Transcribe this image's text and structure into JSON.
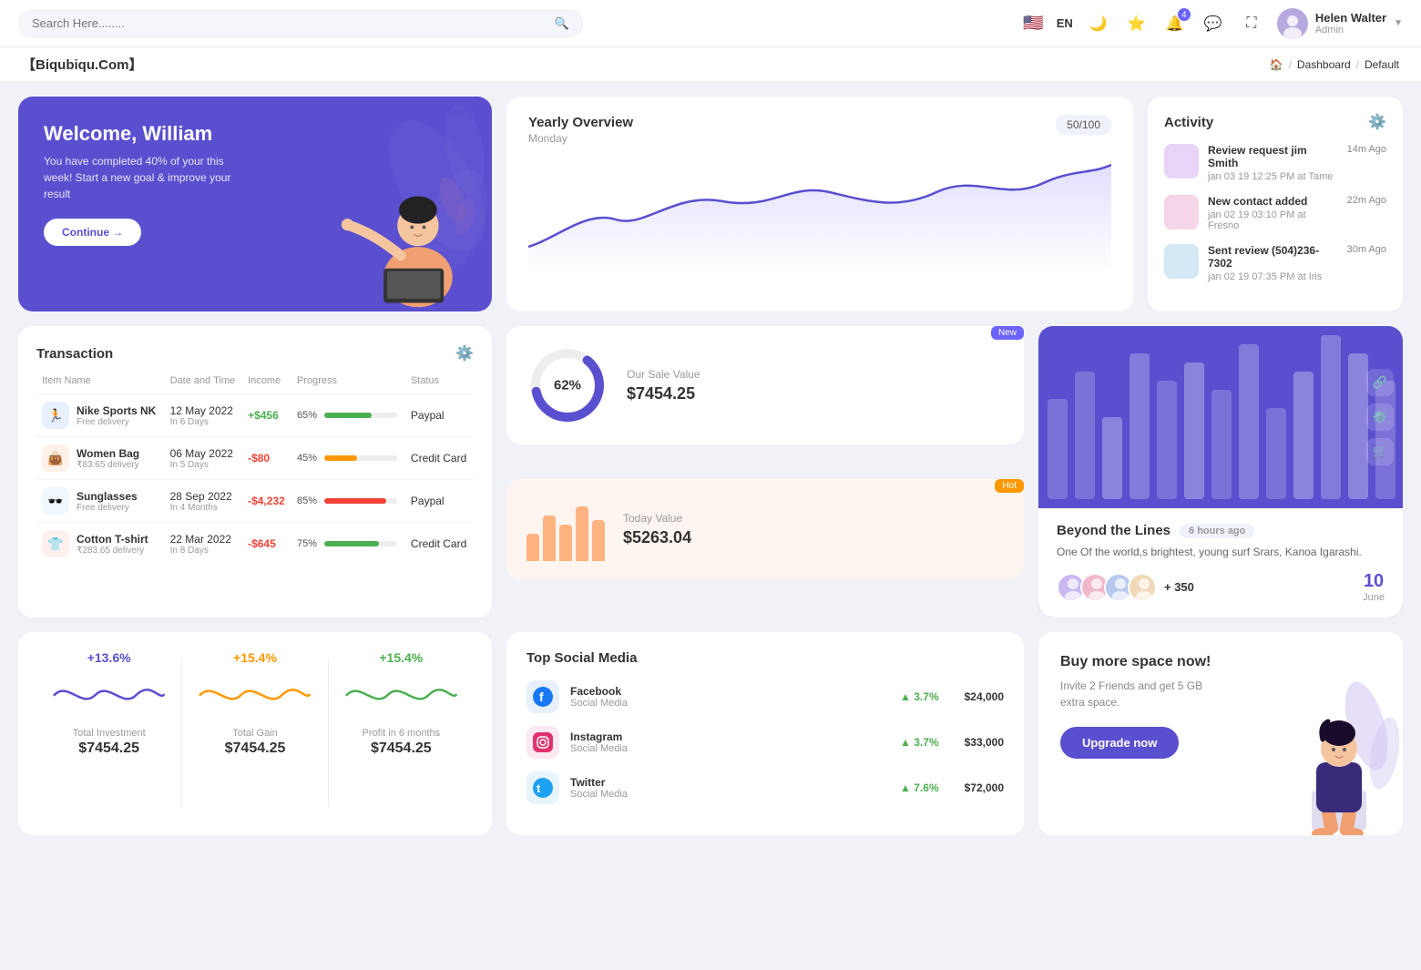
{
  "topnav": {
    "search_placeholder": "Search Here........",
    "lang": "EN",
    "user": {
      "name": "Helen Walter",
      "role": "Admin",
      "avatar_text": "HW"
    },
    "notification_count": "4"
  },
  "breadcrumb": {
    "brand": "【Biqubiqu.Com】",
    "home": "🏠",
    "links": [
      "Dashboard",
      "Default"
    ]
  },
  "welcome": {
    "title": "Welcome, William",
    "description": "You have completed 40% of your this week! Start a new goal & improve your result",
    "button": "Continue →"
  },
  "yearly_overview": {
    "title": "Yearly Overview",
    "subtitle": "Monday",
    "badge": "50/100"
  },
  "activity": {
    "title": "Activity",
    "items": [
      {
        "title": "Review request jim Smith",
        "subtitle": "jan 03 19 12:25 PM at Tame",
        "time": "14m Ago"
      },
      {
        "title": "New contact added",
        "subtitle": "jan 02 19 03:10 PM at Fresno",
        "time": "22m Ago"
      },
      {
        "title": "Sent review (504)236-7302",
        "subtitle": "jan 02 19 07:35 PM at Iris",
        "time": "30m Ago"
      }
    ]
  },
  "transaction": {
    "title": "Transaction",
    "columns": [
      "Item Name",
      "Date and Time",
      "Income",
      "Progress",
      "Status"
    ],
    "rows": [
      {
        "icon": "🏃",
        "icon_bg": "#e8f0ff",
        "name": "Nike Sports NK",
        "desc": "Free delivery",
        "date": "12 May 2022",
        "days": "In 6 Days",
        "income": "+$456",
        "income_type": "pos",
        "progress": 65,
        "progress_color": "#4caf50",
        "status": "Paypal"
      },
      {
        "icon": "👜",
        "icon_bg": "#fff0e8",
        "name": "Women Bag",
        "desc": "₹83.65 delivery",
        "date": "06 May 2022",
        "days": "In 5 Days",
        "income": "-$80",
        "income_type": "neg",
        "progress": 45,
        "progress_color": "#ff9800",
        "status": "Credit Card"
      },
      {
        "icon": "🕶️",
        "icon_bg": "#f0f8ff",
        "name": "Sunglasses",
        "desc": "Free delivery",
        "date": "28 Sep 2022",
        "days": "In 4 Months",
        "income": "-$4,232",
        "income_type": "neg",
        "progress": 85,
        "progress_color": "#f44336",
        "status": "Paypal"
      },
      {
        "icon": "👕",
        "icon_bg": "#fff0f0",
        "name": "Cotton T-shirt",
        "desc": "₹283.65 delivery",
        "date": "22 Mar 2022",
        "days": "In 8 Days",
        "income": "-$645",
        "income_type": "neg",
        "progress": 75,
        "progress_color": "#4caf50",
        "status": "Credit Card"
      }
    ]
  },
  "sale_value": {
    "badge": "New",
    "donut_pct": "62%",
    "title": "Our Sale Value",
    "value": "$7454.25"
  },
  "today_value": {
    "badge": "Hot",
    "title": "Today Value",
    "value": "$5263.04"
  },
  "beyond": {
    "title": "Beyond the Lines",
    "time_ago": "6 hours ago",
    "description": "One Of the world,s brightest, young surf Srars, Kanoa Igarashi.",
    "plus_count": "+ 350",
    "date_num": "10",
    "date_month": "June"
  },
  "stats": [
    {
      "pct": "+13.6%",
      "color": "purple",
      "label": "Total Investment",
      "value": "$7454.25"
    },
    {
      "pct": "+15.4%",
      "color": "orange",
      "label": "Total Gain",
      "value": "$7454.25"
    },
    {
      "pct": "+15.4%",
      "color": "green",
      "label": "Profit in 6 months",
      "value": "$7454.25"
    }
  ],
  "social_media": {
    "title": "Top Social Media",
    "items": [
      {
        "name": "Facebook",
        "sub": "Social Media",
        "pct": "3.7%",
        "amount": "$24,000",
        "icon": "f",
        "color": "#1877f2",
        "bg": "#e8f0fe"
      },
      {
        "name": "Instagram",
        "sub": "Social Media",
        "pct": "3.7%",
        "amount": "$33,000",
        "icon": "ig",
        "color": "#e1306c",
        "bg": "#fce8f3"
      },
      {
        "name": "Twitter",
        "sub": "Social Media",
        "pct": "7.6%",
        "amount": "$72,000",
        "icon": "t",
        "color": "#1da1f2",
        "bg": "#e8f5fe"
      }
    ]
  },
  "buy_space": {
    "title": "Buy more space now!",
    "description": "Invite 2 Friends and get 5 GB extra space.",
    "button": "Upgrade now"
  }
}
